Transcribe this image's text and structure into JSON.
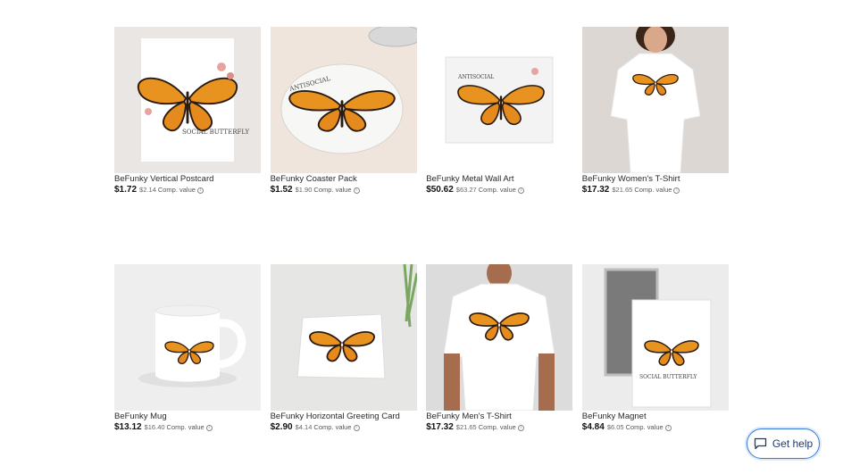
{
  "products": [
    {
      "title": "BeFunky Vertical Postcard",
      "price": "$1.72",
      "comp_price": "$2.14",
      "comp_label": "Comp. value",
      "image": "vertical-postcard-image",
      "thumb_bg": "#e9e6e3"
    },
    {
      "title": "BeFunky Coaster Pack",
      "price": "$1.52",
      "comp_price": "$1.90",
      "comp_label": "Comp. value",
      "image": "coaster-pack-image",
      "thumb_bg": "#efe5dc"
    },
    {
      "title": "BeFunky Metal Wall Art",
      "price": "$50.62",
      "comp_price": "$63.27",
      "comp_label": "Comp. value",
      "image": "metal-wall-art-image",
      "thumb_bg": "#ffffff"
    },
    {
      "title": "BeFunky Women's T-Shirt",
      "price": "$17.32",
      "comp_price": "$21.65",
      "comp_label": "Comp. value",
      "image": "womens-tshirt-image",
      "thumb_bg": "#ddd7d3"
    },
    {
      "title": "BeFunky Mug",
      "price": "$13.12",
      "comp_price": "$16.40",
      "comp_label": "Comp. value",
      "image": "mug-image",
      "thumb_bg": "#eeeeee"
    },
    {
      "title": "BeFunky Horizontal Greeting Card",
      "price": "$2.90",
      "comp_price": "$4.14",
      "comp_label": "Comp. value",
      "image": "greeting-card-image",
      "thumb_bg": "#e6e6e4"
    },
    {
      "title": "BeFunky Men's T-Shirt",
      "price": "$17.32",
      "comp_price": "$21.65",
      "comp_label": "Comp. value",
      "image": "mens-tshirt-image",
      "thumb_bg": "#dcdcdc"
    },
    {
      "title": "BeFunky Magnet",
      "price": "$4.84",
      "comp_price": "$6.05",
      "comp_label": "Comp. value",
      "image": "magnet-image",
      "thumb_bg": "#ececec"
    }
  ],
  "help": {
    "label": "Get help",
    "icon": "chat-bubble-icon"
  },
  "info_icon": "info-icon",
  "colors": {
    "accent": "#3a7bd5",
    "butterfly_orange": "#e8931f"
  }
}
